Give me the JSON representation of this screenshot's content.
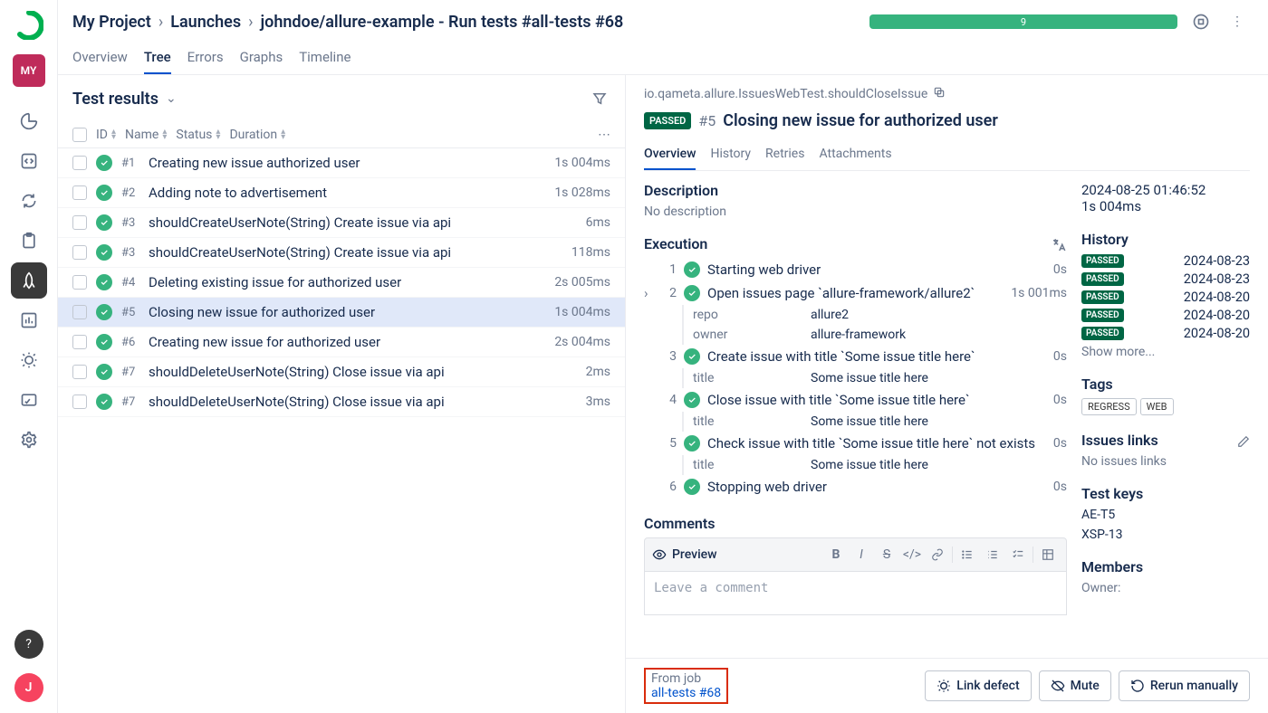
{
  "sidebar": {
    "project_short": "MY",
    "user_initial": "J"
  },
  "breadcrumb": {
    "project": "My Project",
    "launches": "Launches",
    "run": "johndoe/allure-example - Run tests #all-tests #68"
  },
  "progress": {
    "count": "9"
  },
  "tabs": [
    "Overview",
    "Tree",
    "Errors",
    "Graphs",
    "Timeline"
  ],
  "active_tab": "Tree",
  "left": {
    "title": "Test results",
    "columns": {
      "id": "ID",
      "name": "Name",
      "status": "Status",
      "duration": "Duration"
    },
    "rows": [
      {
        "id": "#1",
        "name": "Creating new issue authorized user",
        "duration": "1s 004ms"
      },
      {
        "id": "#2",
        "name": "Adding note to advertisement",
        "duration": "1s 028ms"
      },
      {
        "id": "#3",
        "name": "shouldCreateUserNote(String) Create issue via api",
        "duration": "6ms"
      },
      {
        "id": "#3",
        "name": "shouldCreateUserNote(String) Create issue via api",
        "duration": "118ms"
      },
      {
        "id": "#4",
        "name": "Deleting existing issue for authorized user",
        "duration": "2s 005ms"
      },
      {
        "id": "#5",
        "name": "Closing new issue for authorized user",
        "duration": "1s 004ms"
      },
      {
        "id": "#6",
        "name": "Creating new issue for authorized user",
        "duration": "2s 004ms"
      },
      {
        "id": "#7",
        "name": "shouldDeleteUserNote(String) Close issue via api",
        "duration": "2ms"
      },
      {
        "id": "#7",
        "name": "shouldDeleteUserNote(String) Close issue via api",
        "duration": "3ms"
      }
    ],
    "selected_index": 5
  },
  "detail": {
    "qname": "io.qameta.allure.IssuesWebTest.shouldCloseIssue",
    "status": "PASSED",
    "id": "#5",
    "title": "Closing new issue for authorized user",
    "tabs": [
      "Overview",
      "History",
      "Retries",
      "Attachments"
    ],
    "active_tab": "Overview",
    "description_h": "Description",
    "description": "No description",
    "execution_h": "Execution",
    "steps": [
      {
        "num": "1",
        "name": "Starting web driver",
        "duration": "0s",
        "expandable": false
      },
      {
        "num": "2",
        "name": "Open issues page `allure-framework/allure2`",
        "duration": "1s 001ms",
        "expandable": true,
        "params": [
          {
            "k": "repo",
            "v": "allure2"
          },
          {
            "k": "owner",
            "v": "allure-framework"
          }
        ]
      },
      {
        "num": "3",
        "name": "Create issue with title `Some issue title here`",
        "duration": "0s",
        "expandable": false,
        "params": [
          {
            "k": "title",
            "v": "Some issue title here"
          }
        ]
      },
      {
        "num": "4",
        "name": "Close issue with title `Some issue title here`",
        "duration": "0s",
        "expandable": false,
        "params": [
          {
            "k": "title",
            "v": "Some issue title here"
          }
        ]
      },
      {
        "num": "5",
        "name": "Check issue with title `Some issue title here` not exists",
        "duration": "0s",
        "expandable": false,
        "params": [
          {
            "k": "title",
            "v": "Some issue title here"
          }
        ]
      },
      {
        "num": "6",
        "name": "Stopping web driver",
        "duration": "0s",
        "expandable": false
      }
    ],
    "comments_h": "Comments",
    "preview_label": "Preview",
    "comment_placeholder": "Leave a comment",
    "timestamp": "2024-08-25 01:46:52",
    "elapsed": "1s 004ms",
    "history_h": "History",
    "history": [
      {
        "status": "PASSED",
        "date": "2024-08-23"
      },
      {
        "status": "PASSED",
        "date": "2024-08-23"
      },
      {
        "status": "PASSED",
        "date": "2024-08-20"
      },
      {
        "status": "PASSED",
        "date": "2024-08-20"
      },
      {
        "status": "PASSED",
        "date": "2024-08-20"
      }
    ],
    "show_more": "Show more...",
    "tags_h": "Tags",
    "tags": [
      "REGRESS",
      "WEB"
    ],
    "issues_h": "Issues links",
    "issues_empty": "No issues links",
    "keys_h": "Test keys",
    "keys": [
      "AE-T5",
      "XSP-13"
    ],
    "members_h": "Members",
    "owner_label": "Owner:"
  },
  "footer": {
    "from_label": "From job",
    "job_link": "all-tests #68",
    "link_defect": "Link defect",
    "mute": "Mute",
    "rerun": "Rerun manually"
  }
}
